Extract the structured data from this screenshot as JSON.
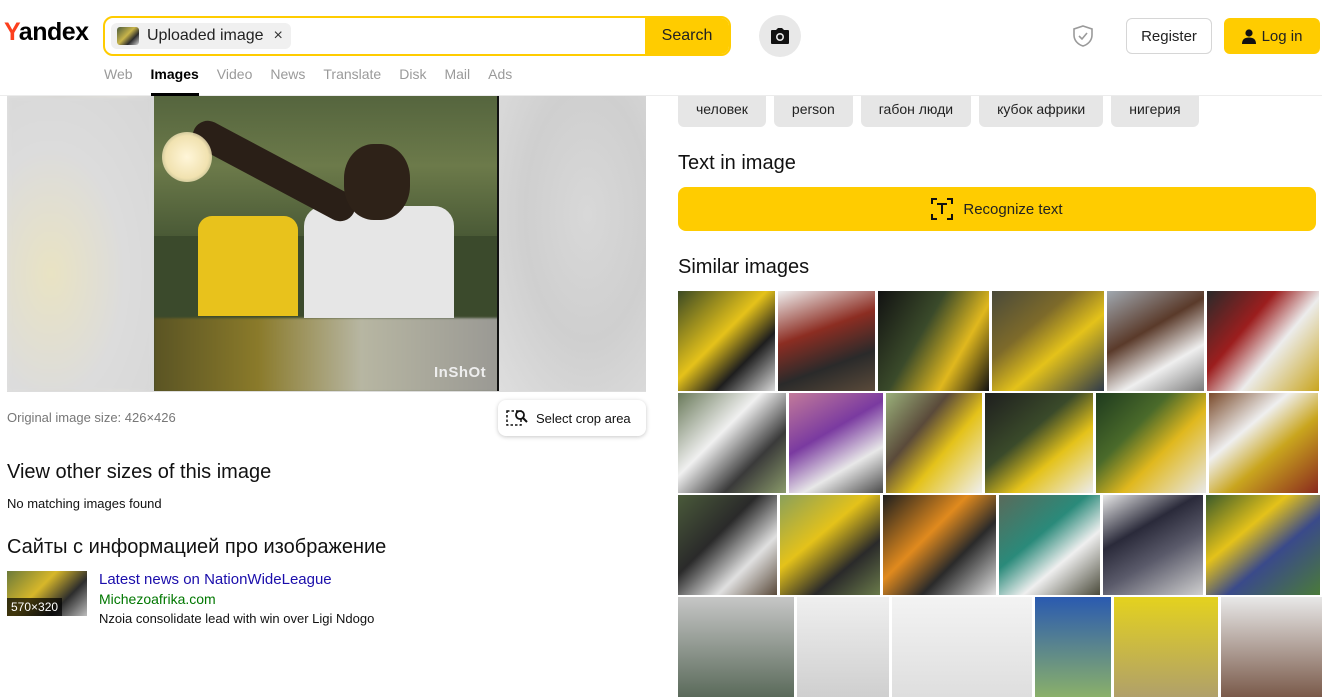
{
  "header": {
    "logo_y": "Y",
    "logo_rest": "andex",
    "search_chip": "Uploaded image",
    "search_chip_close": "×",
    "search_button": "Search",
    "register": "Register",
    "login": "Log in"
  },
  "tabs": [
    "Web",
    "Images",
    "Video",
    "News",
    "Translate",
    "Disk",
    "Mail",
    "Ads"
  ],
  "active_tab": "Images",
  "preview": {
    "watermark": "InShOt"
  },
  "left": {
    "original_size": "Original image size: 426×426",
    "crop_button": "Select crop area",
    "other_sizes_heading": "View other sizes of this image",
    "no_match": "No matching images found",
    "sites_heading": "Сайты с информацией про изображение",
    "site": {
      "thumb_size": "570×320",
      "title": "Latest news on NationWideLeague",
      "domain": "Michezoafrika.com",
      "description": "Nzoia consolidate lead with win over Ligi Ndogo"
    }
  },
  "right": {
    "tags": [
      "человек",
      "person",
      "габон люди",
      "кубок африки",
      "нигерия"
    ],
    "text_heading": "Text in image",
    "recognize_button": "Recognize text",
    "similar_heading": "Similar images"
  },
  "colors": {
    "accent": "#ffcc00",
    "logo_red": "#fc3f1d",
    "link": "#1a0dab",
    "domain": "#007700"
  },
  "icons": [
    "camera-icon",
    "shield-icon",
    "user-icon",
    "close-icon",
    "crop-icon",
    "text-scan-icon"
  ]
}
